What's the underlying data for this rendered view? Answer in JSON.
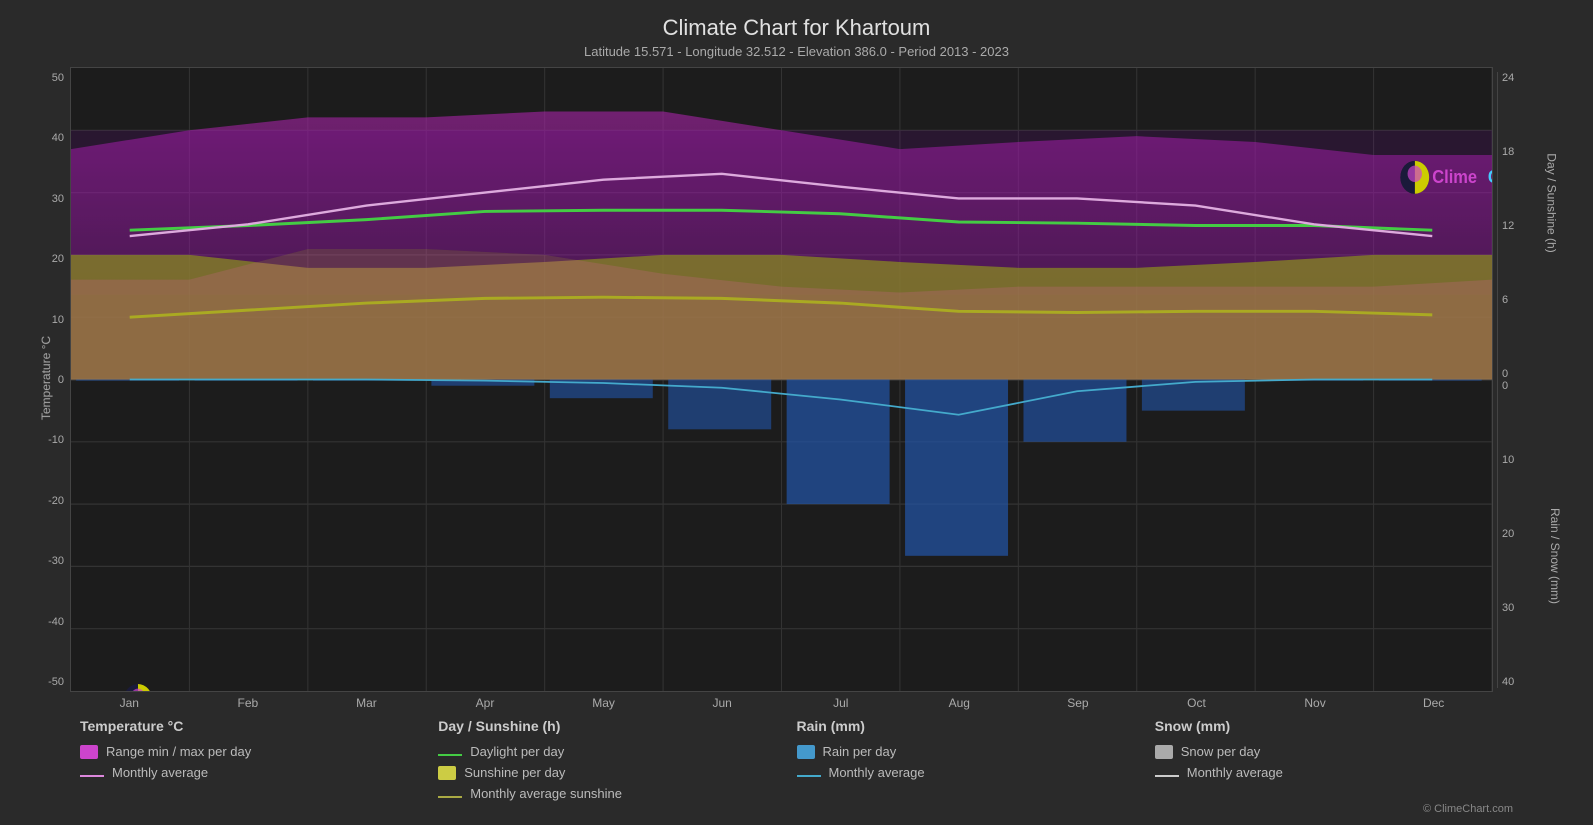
{
  "title": "Climate Chart for Khartoum",
  "subtitle": "Latitude 15.571 - Longitude 32.512 - Elevation 386.0 - Period 2013 - 2023",
  "leftAxis": {
    "title": "Temperature °C",
    "labels": [
      "50",
      "40",
      "30",
      "20",
      "10",
      "0",
      "-10",
      "-20",
      "-30",
      "-40",
      "-50"
    ]
  },
  "rightAxisTop": {
    "title": "Day / Sunshine (h)",
    "labels": [
      "24",
      "18",
      "12",
      "6",
      "0"
    ]
  },
  "rightAxisBottom": {
    "title": "Rain / Snow (mm)",
    "labels": [
      "0",
      "10",
      "20",
      "30",
      "40"
    ]
  },
  "xAxis": {
    "labels": [
      "Jan",
      "Feb",
      "Mar",
      "Apr",
      "May",
      "Jun",
      "Jul",
      "Aug",
      "Sep",
      "Oct",
      "Nov",
      "Dec"
    ]
  },
  "legend": {
    "cols": [
      {
        "title": "Temperature °C",
        "items": [
          {
            "type": "swatch",
            "color": "#cc44cc",
            "label": "Range min / max per day"
          },
          {
            "type": "line",
            "color": "#dd88dd",
            "label": "Monthly average"
          }
        ]
      },
      {
        "title": "Day / Sunshine (h)",
        "items": [
          {
            "type": "line",
            "color": "#44cc44",
            "label": "Daylight per day"
          },
          {
            "type": "swatch",
            "color": "#cccc44",
            "label": "Sunshine per day"
          },
          {
            "type": "line",
            "color": "#aaaa44",
            "label": "Monthly average sunshine"
          }
        ]
      },
      {
        "title": "Rain (mm)",
        "items": [
          {
            "type": "swatch",
            "color": "#4499cc",
            "label": "Rain per day"
          },
          {
            "type": "line",
            "color": "#44aacc",
            "label": "Monthly average"
          }
        ]
      },
      {
        "title": "Snow (mm)",
        "items": [
          {
            "type": "swatch",
            "color": "#aaaaaa",
            "label": "Snow per day"
          },
          {
            "type": "line",
            "color": "#cccccc",
            "label": "Monthly average"
          }
        ]
      }
    ]
  },
  "copyright": "© ClimeChart.com",
  "logo": {
    "text_clime": "Clime",
    "text_chart": "Chart.com"
  }
}
